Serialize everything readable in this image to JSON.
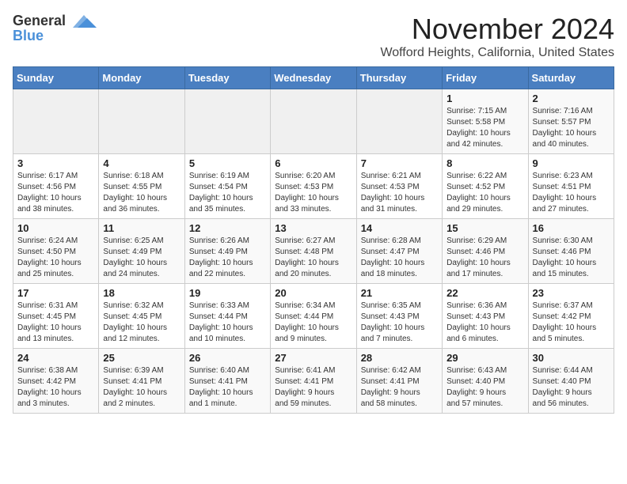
{
  "header": {
    "logo_line1": "General",
    "logo_line2": "Blue",
    "month_title": "November 2024",
    "location": "Wofford Heights, California, United States"
  },
  "calendar": {
    "days_of_week": [
      "Sunday",
      "Monday",
      "Tuesday",
      "Wednesday",
      "Thursday",
      "Friday",
      "Saturday"
    ],
    "weeks": [
      [
        {
          "day": "",
          "info": ""
        },
        {
          "day": "",
          "info": ""
        },
        {
          "day": "",
          "info": ""
        },
        {
          "day": "",
          "info": ""
        },
        {
          "day": "",
          "info": ""
        },
        {
          "day": "1",
          "info": "Sunrise: 7:15 AM\nSunset: 5:58 PM\nDaylight: 10 hours\nand 42 minutes."
        },
        {
          "day": "2",
          "info": "Sunrise: 7:16 AM\nSunset: 5:57 PM\nDaylight: 10 hours\nand 40 minutes."
        }
      ],
      [
        {
          "day": "3",
          "info": "Sunrise: 6:17 AM\nSunset: 4:56 PM\nDaylight: 10 hours\nand 38 minutes."
        },
        {
          "day": "4",
          "info": "Sunrise: 6:18 AM\nSunset: 4:55 PM\nDaylight: 10 hours\nand 36 minutes."
        },
        {
          "day": "5",
          "info": "Sunrise: 6:19 AM\nSunset: 4:54 PM\nDaylight: 10 hours\nand 35 minutes."
        },
        {
          "day": "6",
          "info": "Sunrise: 6:20 AM\nSunset: 4:53 PM\nDaylight: 10 hours\nand 33 minutes."
        },
        {
          "day": "7",
          "info": "Sunrise: 6:21 AM\nSunset: 4:53 PM\nDaylight: 10 hours\nand 31 minutes."
        },
        {
          "day": "8",
          "info": "Sunrise: 6:22 AM\nSunset: 4:52 PM\nDaylight: 10 hours\nand 29 minutes."
        },
        {
          "day": "9",
          "info": "Sunrise: 6:23 AM\nSunset: 4:51 PM\nDaylight: 10 hours\nand 27 minutes."
        }
      ],
      [
        {
          "day": "10",
          "info": "Sunrise: 6:24 AM\nSunset: 4:50 PM\nDaylight: 10 hours\nand 25 minutes."
        },
        {
          "day": "11",
          "info": "Sunrise: 6:25 AM\nSunset: 4:49 PM\nDaylight: 10 hours\nand 24 minutes."
        },
        {
          "day": "12",
          "info": "Sunrise: 6:26 AM\nSunset: 4:49 PM\nDaylight: 10 hours\nand 22 minutes."
        },
        {
          "day": "13",
          "info": "Sunrise: 6:27 AM\nSunset: 4:48 PM\nDaylight: 10 hours\nand 20 minutes."
        },
        {
          "day": "14",
          "info": "Sunrise: 6:28 AM\nSunset: 4:47 PM\nDaylight: 10 hours\nand 18 minutes."
        },
        {
          "day": "15",
          "info": "Sunrise: 6:29 AM\nSunset: 4:46 PM\nDaylight: 10 hours\nand 17 minutes."
        },
        {
          "day": "16",
          "info": "Sunrise: 6:30 AM\nSunset: 4:46 PM\nDaylight: 10 hours\nand 15 minutes."
        }
      ],
      [
        {
          "day": "17",
          "info": "Sunrise: 6:31 AM\nSunset: 4:45 PM\nDaylight: 10 hours\nand 13 minutes."
        },
        {
          "day": "18",
          "info": "Sunrise: 6:32 AM\nSunset: 4:45 PM\nDaylight: 10 hours\nand 12 minutes."
        },
        {
          "day": "19",
          "info": "Sunrise: 6:33 AM\nSunset: 4:44 PM\nDaylight: 10 hours\nand 10 minutes."
        },
        {
          "day": "20",
          "info": "Sunrise: 6:34 AM\nSunset: 4:44 PM\nDaylight: 10 hours\nand 9 minutes."
        },
        {
          "day": "21",
          "info": "Sunrise: 6:35 AM\nSunset: 4:43 PM\nDaylight: 10 hours\nand 7 minutes."
        },
        {
          "day": "22",
          "info": "Sunrise: 6:36 AM\nSunset: 4:43 PM\nDaylight: 10 hours\nand 6 minutes."
        },
        {
          "day": "23",
          "info": "Sunrise: 6:37 AM\nSunset: 4:42 PM\nDaylight: 10 hours\nand 5 minutes."
        }
      ],
      [
        {
          "day": "24",
          "info": "Sunrise: 6:38 AM\nSunset: 4:42 PM\nDaylight: 10 hours\nand 3 minutes."
        },
        {
          "day": "25",
          "info": "Sunrise: 6:39 AM\nSunset: 4:41 PM\nDaylight: 10 hours\nand 2 minutes."
        },
        {
          "day": "26",
          "info": "Sunrise: 6:40 AM\nSunset: 4:41 PM\nDaylight: 10 hours\nand 1 minute."
        },
        {
          "day": "27",
          "info": "Sunrise: 6:41 AM\nSunset: 4:41 PM\nDaylight: 9 hours\nand 59 minutes."
        },
        {
          "day": "28",
          "info": "Sunrise: 6:42 AM\nSunset: 4:41 PM\nDaylight: 9 hours\nand 58 minutes."
        },
        {
          "day": "29",
          "info": "Sunrise: 6:43 AM\nSunset: 4:40 PM\nDaylight: 9 hours\nand 57 minutes."
        },
        {
          "day": "30",
          "info": "Sunrise: 6:44 AM\nSunset: 4:40 PM\nDaylight: 9 hours\nand 56 minutes."
        }
      ]
    ]
  }
}
